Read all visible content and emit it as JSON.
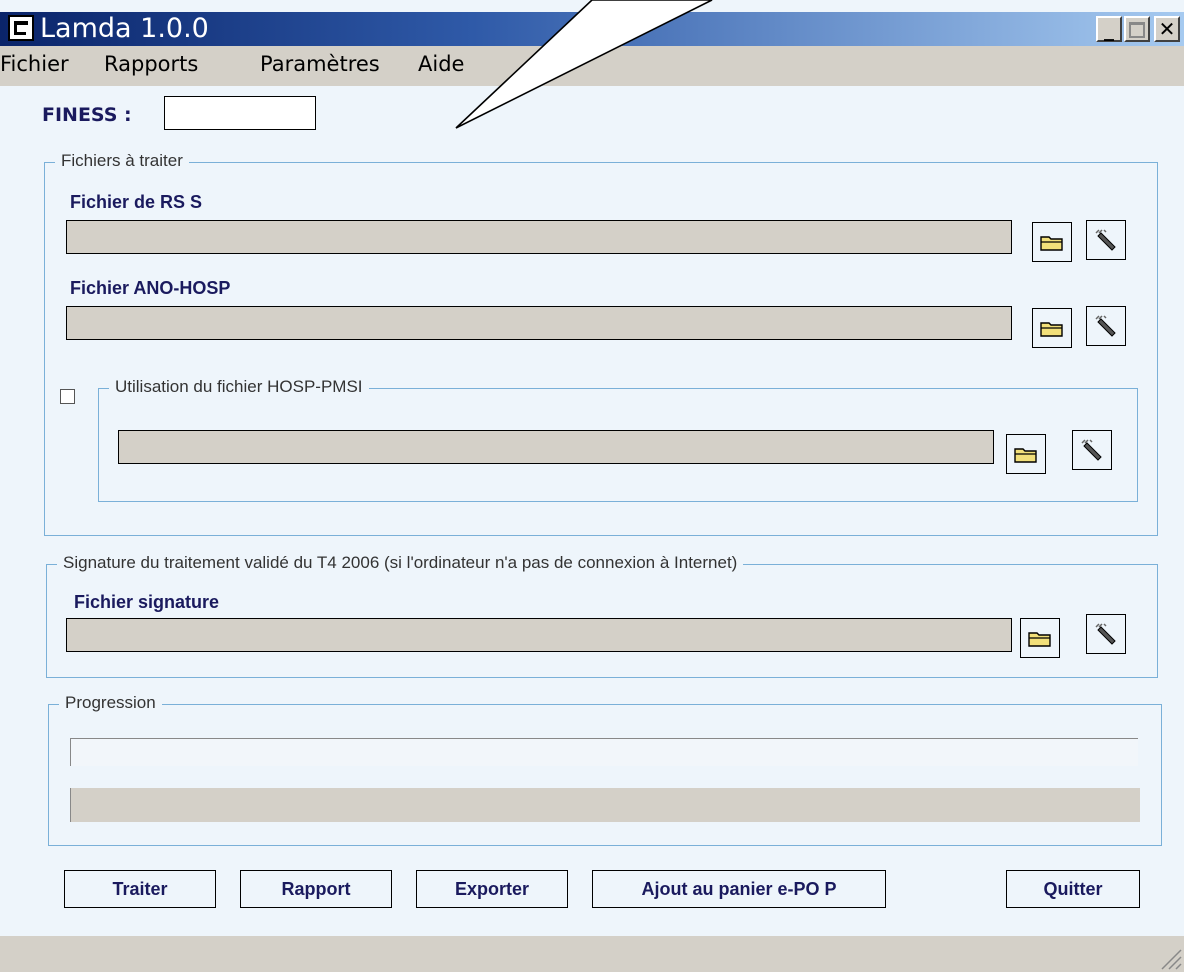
{
  "window": {
    "title": "Lamda 1.0.0"
  },
  "menu": [
    "Fichier",
    "Rapports",
    "Paramètres",
    "Aide"
  ],
  "finess": {
    "label": "FINESS :",
    "value": ""
  },
  "files_group": {
    "legend": "Fichiers à traiter",
    "rss_label": "Fichier de RS S",
    "ano_label": "Fichier ANO-HOSP",
    "hosp_pmsi_legend": "Utilisation du fichier HOSP-PMSI",
    "hosp_pmsi_checked": false
  },
  "signature_group": {
    "legend": "Signature du traitement validé du T4 2006 (si l'ordinateur n'a pas de connexion à Internet)",
    "file_label": "Fichier signature"
  },
  "progress_group": {
    "legend": "Progression"
  },
  "buttons": {
    "traiter": "Traiter",
    "rapport": "Rapport",
    "exporter": "Exporter",
    "ajout": "Ajout au panier e-PO P",
    "quitter": "Quitter"
  },
  "icons": {
    "browse": "folder-icon",
    "clear": "eraser-icon"
  }
}
